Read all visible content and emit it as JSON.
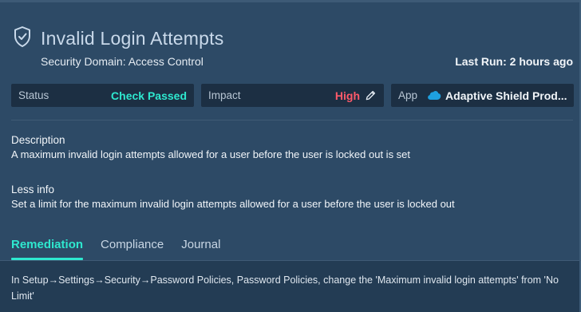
{
  "header": {
    "title": "Invalid Login Attempts",
    "subtitle": "Security Domain: Access Control",
    "last_run": "Last Run: 2 hours ago",
    "icon": "shield-check-icon"
  },
  "cards": {
    "status": {
      "label": "Status",
      "value": "Check Passed"
    },
    "impact": {
      "label": "Impact",
      "value": "High"
    },
    "app": {
      "label": "App",
      "value": "Adaptive Shield Prod..."
    }
  },
  "description": {
    "heading": "Description",
    "text": "A maximum invalid login attempts allowed for a user before the user is locked out is set"
  },
  "less_info": {
    "heading": "Less info",
    "text": "Set a limit for the maximum invalid login attempts allowed for a user before the user is locked out"
  },
  "tabs": [
    {
      "label": "Remediation",
      "active": true
    },
    {
      "label": "Compliance",
      "active": false
    },
    {
      "label": "Journal",
      "active": false
    }
  ],
  "remediation": {
    "text": "In Setup→Settings→Security→Password Policies, Password Policies, change the 'Maximum invalid login attempts' from 'No Limit'"
  },
  "colors": {
    "background": "#2d4a66",
    "accent": "#2ee8cf",
    "impact_high": "#ff5a6a",
    "card_bg": "#1c2f43",
    "salesforce_blue": "#1ea0e0"
  }
}
